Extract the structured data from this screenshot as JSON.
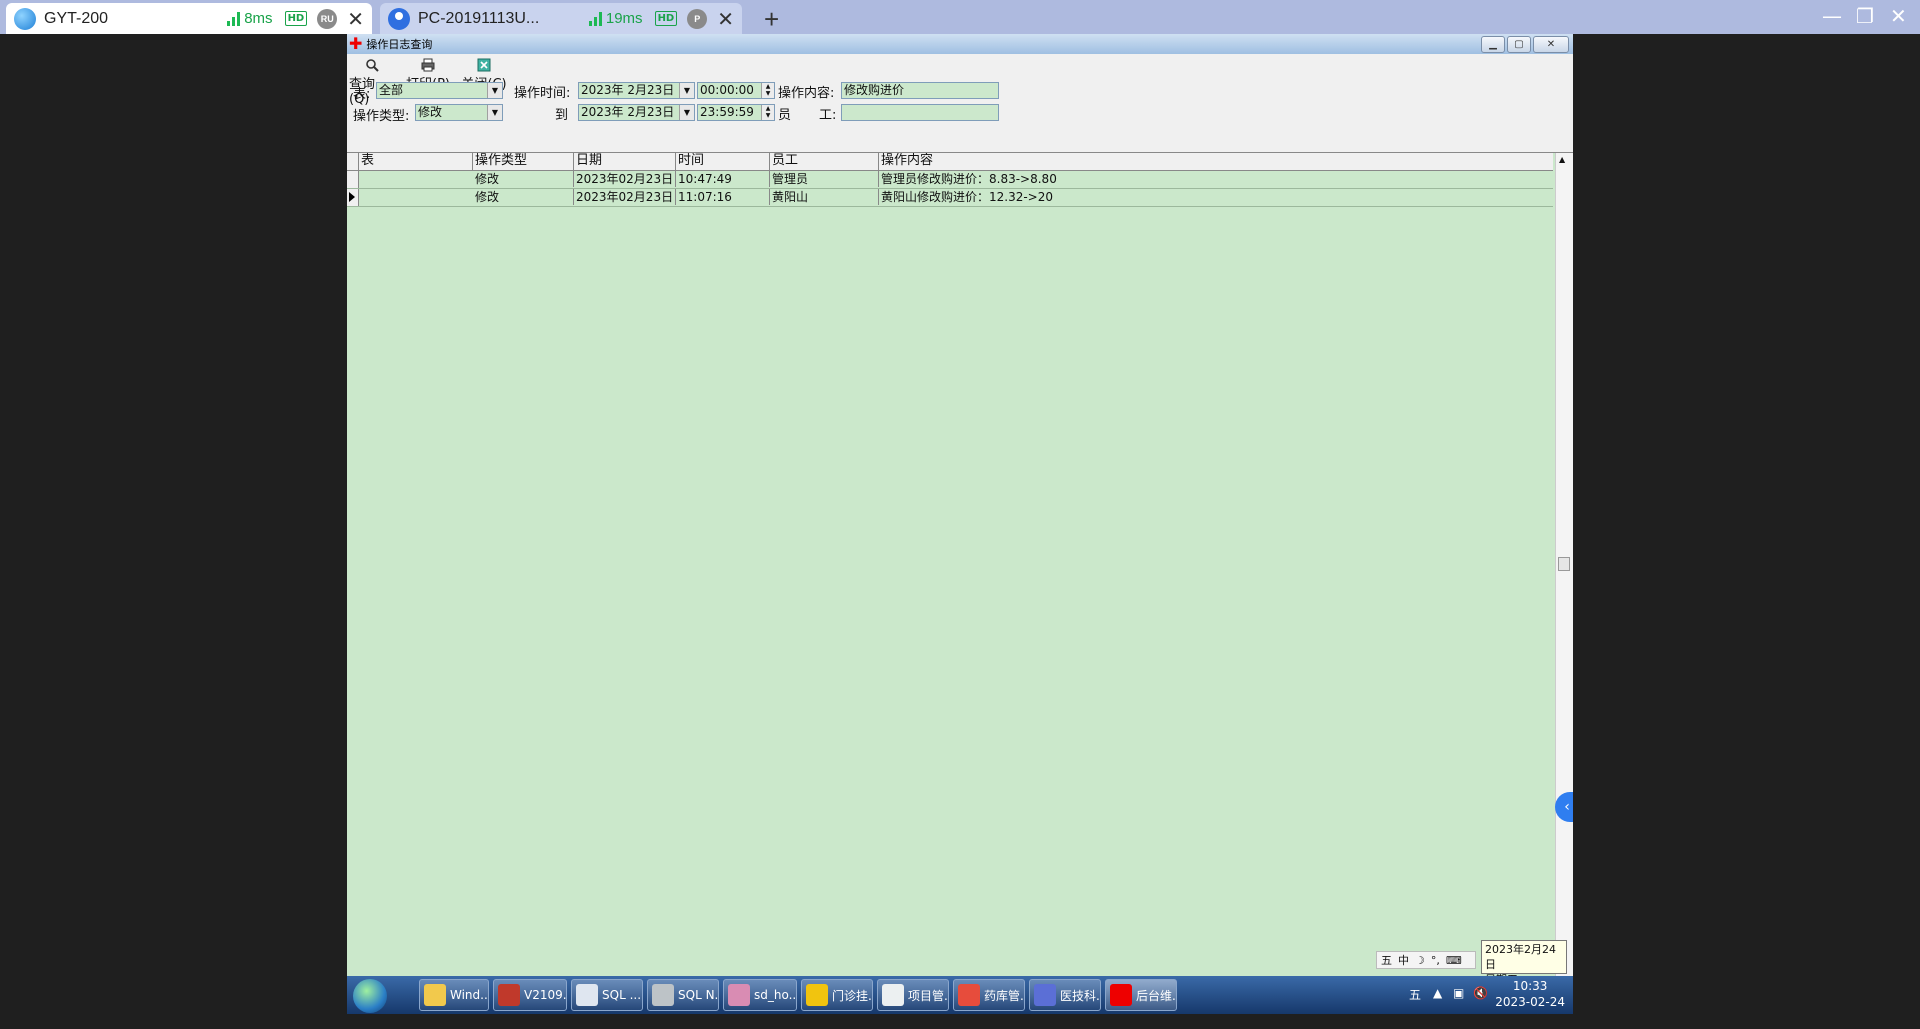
{
  "client_tabs": [
    {
      "name": "GYT-200",
      "ping": "8ms",
      "hd": "HD",
      "badge": "RU"
    },
    {
      "name": "PC-20191113U...",
      "ping": "19ms",
      "hd": "HD",
      "badge": "P"
    }
  ],
  "window": {
    "title": "操作日志查询"
  },
  "toolbar": {
    "query_label": "查询(Q)",
    "print_label": "打印(P)",
    "close_label": "关闭(C)"
  },
  "filters": {
    "table_label": "表:",
    "table_value": "全部",
    "op_type_label": "操作类型:",
    "op_type_value": "修改",
    "op_time_label": "操作时间:",
    "to_label": "到",
    "start_date": "2023年 2月23日",
    "start_time": "00:00:00",
    "end_date": "2023年 2月23日",
    "end_time": "23:59:59",
    "content_label": "操作内容:",
    "content_value": "修改购进价",
    "staff_label_1": "员",
    "staff_label_2": "工:",
    "staff_value": ""
  },
  "grid": {
    "columns": [
      "表",
      "操作类型",
      "日期",
      "时间",
      "员工",
      "操作内容"
    ],
    "rows": [
      {
        "table": "",
        "type": "修改",
        "date": "2023年02月23日",
        "time": "10:47:49",
        "staff": "管理员",
        "content": "管理员修改购进价：8.83->8.80"
      },
      {
        "table": "",
        "type": "修改",
        "date": "2023年02月23日",
        "time": "11:07:16",
        "staff": "黄阳山",
        "content": "黄阳山修改购进价：12.32->20"
      }
    ]
  },
  "ime": {
    "items": [
      "五",
      "中"
    ]
  },
  "tooltip": {
    "line1": "2023年2月24日",
    "line2": "星期五"
  },
  "taskbar": {
    "items": [
      "Wind...",
      "V2109...",
      "SQL ...",
      "SQL N...",
      "sd_ho...",
      "门诊挂...",
      "项目管...",
      "药库管...",
      "医技科...",
      "后台维..."
    ],
    "tray_ime": "五",
    "clock_time": "10:33",
    "clock_date": "2023-02-24"
  },
  "colors": {
    "grid_bg": "#cbe8cb",
    "field_bg": "#cce8cc",
    "client_bar": "#aebadf"
  }
}
